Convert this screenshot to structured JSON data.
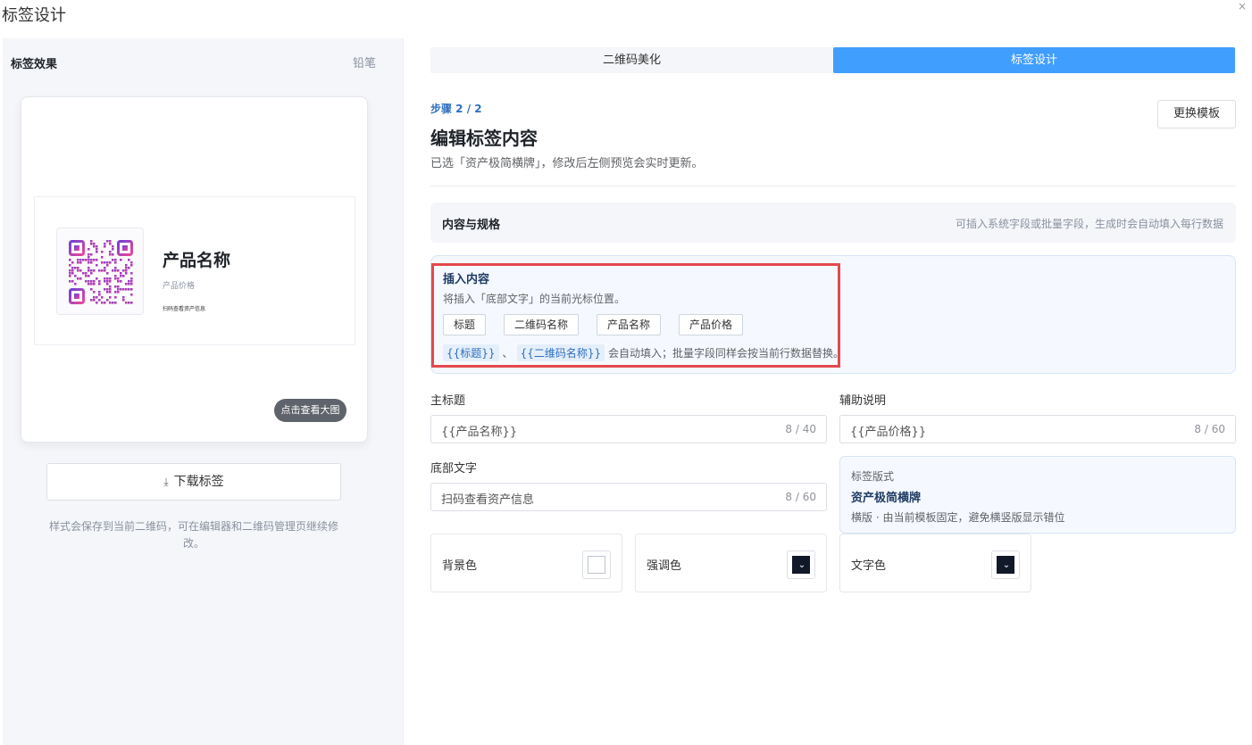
{
  "window": {
    "title": "标签设计",
    "close_glyph": "×"
  },
  "left": {
    "title": "标签效果",
    "pencil_label": "铅笔",
    "preview": {
      "label_title": "产品名称",
      "label_subtitle": "产品价格",
      "label_footer": "扫码查看资产信息",
      "zoom_label": "点击查看大图"
    },
    "download_icon": "download-icon",
    "download_label": "下载标签",
    "note": "样式会保存到当前二维码，可在编辑器和二维码管理页继续修改。"
  },
  "tabs": [
    {
      "label": "二维码美化",
      "active": false
    },
    {
      "label": "标签设计",
      "active": true
    }
  ],
  "header": {
    "step": "步骤 2 / 2",
    "title": "编辑标签内容",
    "description": "已选「资产极简横牌」，修改后左侧预览会实时更新。",
    "switch_template": "更换模板"
  },
  "section": {
    "title": "内容与规格",
    "hint": "可插入系统字段或批量字段，生成时会自动填入每行数据"
  },
  "insert": {
    "title": "插入内容",
    "description": "将插入「底部文字」的当前光标位置。",
    "chips": [
      "标题",
      "二维码名称",
      "产品名称",
      "产品价格"
    ],
    "tokens": [
      "{{标题}}",
      "{{二维码名称}}"
    ],
    "token_separator": "、",
    "token_note": "会自动填入；批量字段同样会按当前行数据替换。"
  },
  "fields": {
    "main_title": {
      "label": "主标题",
      "value": "{{产品名称}}",
      "count": "8 / 40"
    },
    "aux_desc": {
      "label": "辅助说明",
      "value": "{{产品价格}}",
      "count": "8 / 60"
    },
    "footer_text": {
      "label": "底部文字",
      "value": "扫码查看资产信息",
      "count": "8 / 60"
    }
  },
  "layout": {
    "tag": "标签版式",
    "name": "资产极简横牌",
    "note": "横版 · 由当前模板固定，避免横竖版显示错位"
  },
  "colors": [
    {
      "label": "背景色",
      "value": "#ffffff"
    },
    {
      "label": "强调色",
      "value": "#111827"
    },
    {
      "label": "文字色",
      "value": "#111827"
    }
  ],
  "theme": {
    "accent": "#409eff",
    "highlight": "#e5484d",
    "step_color": "#2f6fbd"
  }
}
